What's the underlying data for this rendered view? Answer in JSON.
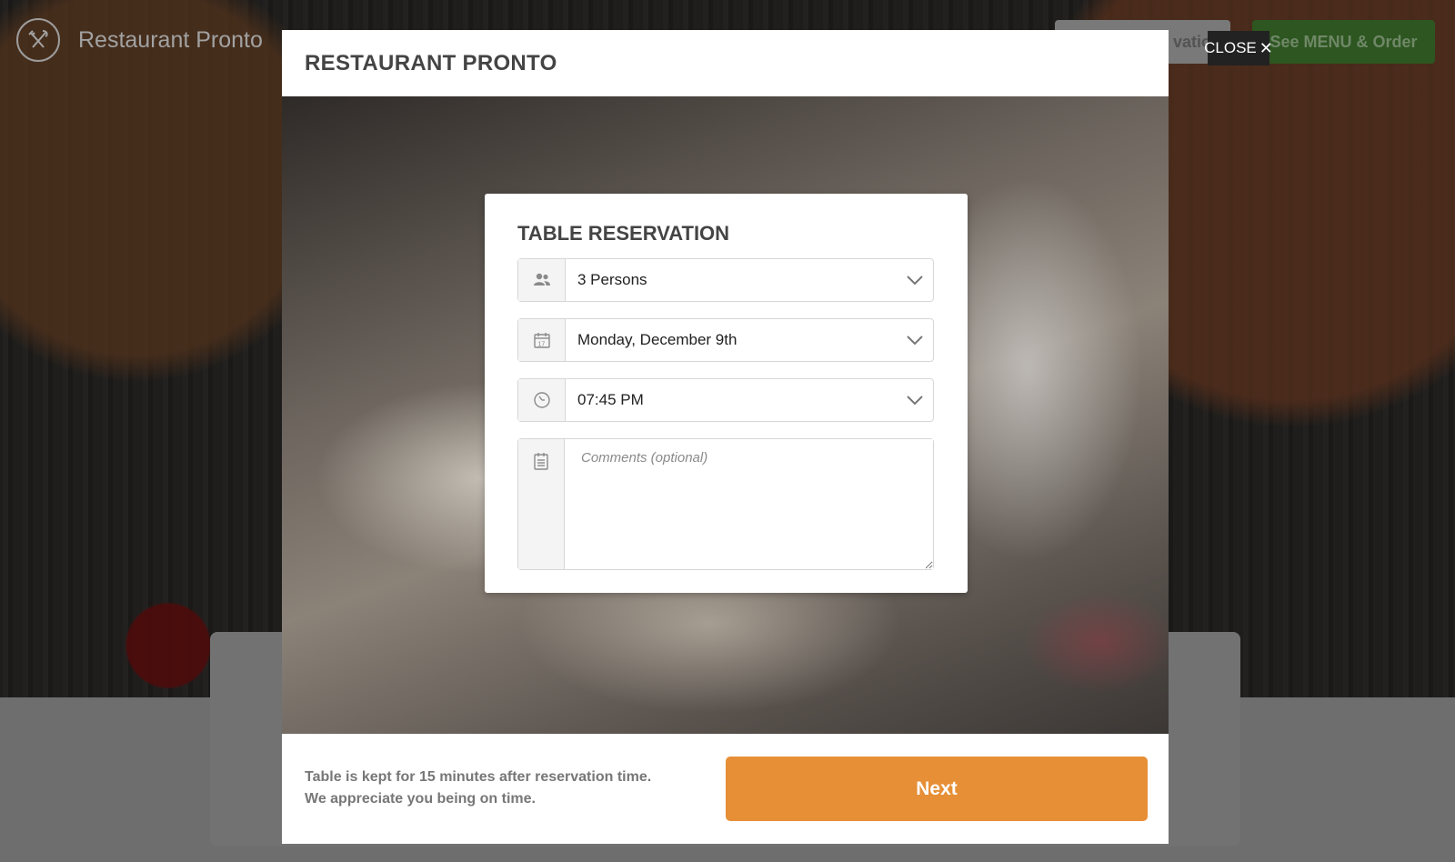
{
  "site": {
    "logo_icon": "fork-knife-icon",
    "name": "Restaurant Pronto",
    "header_buttons": {
      "reservation_label": "vation",
      "menu_label": "See MENU & Order"
    }
  },
  "modal": {
    "title": "RESTAURANT PRONTO",
    "close_label": "CLOSE",
    "close_icon": "close-icon"
  },
  "reservation": {
    "title": "TABLE RESERVATION",
    "persons": {
      "icon": "people-icon",
      "value": "3 Persons"
    },
    "date": {
      "icon": "calendar-icon",
      "value": "Monday, December 9th"
    },
    "time": {
      "icon": "clock-icon",
      "value": "07:45 PM"
    },
    "comments": {
      "icon": "notepad-icon",
      "placeholder": "Comments (optional)"
    }
  },
  "footer": {
    "note_line1": "Table is kept for 15 minutes after reservation time.",
    "note_line2": "We appreciate you being on time.",
    "next_label": "Next"
  },
  "colors": {
    "accent": "#e68f36",
    "menu_button": "#4a8f35",
    "close_bg": "#222222"
  }
}
